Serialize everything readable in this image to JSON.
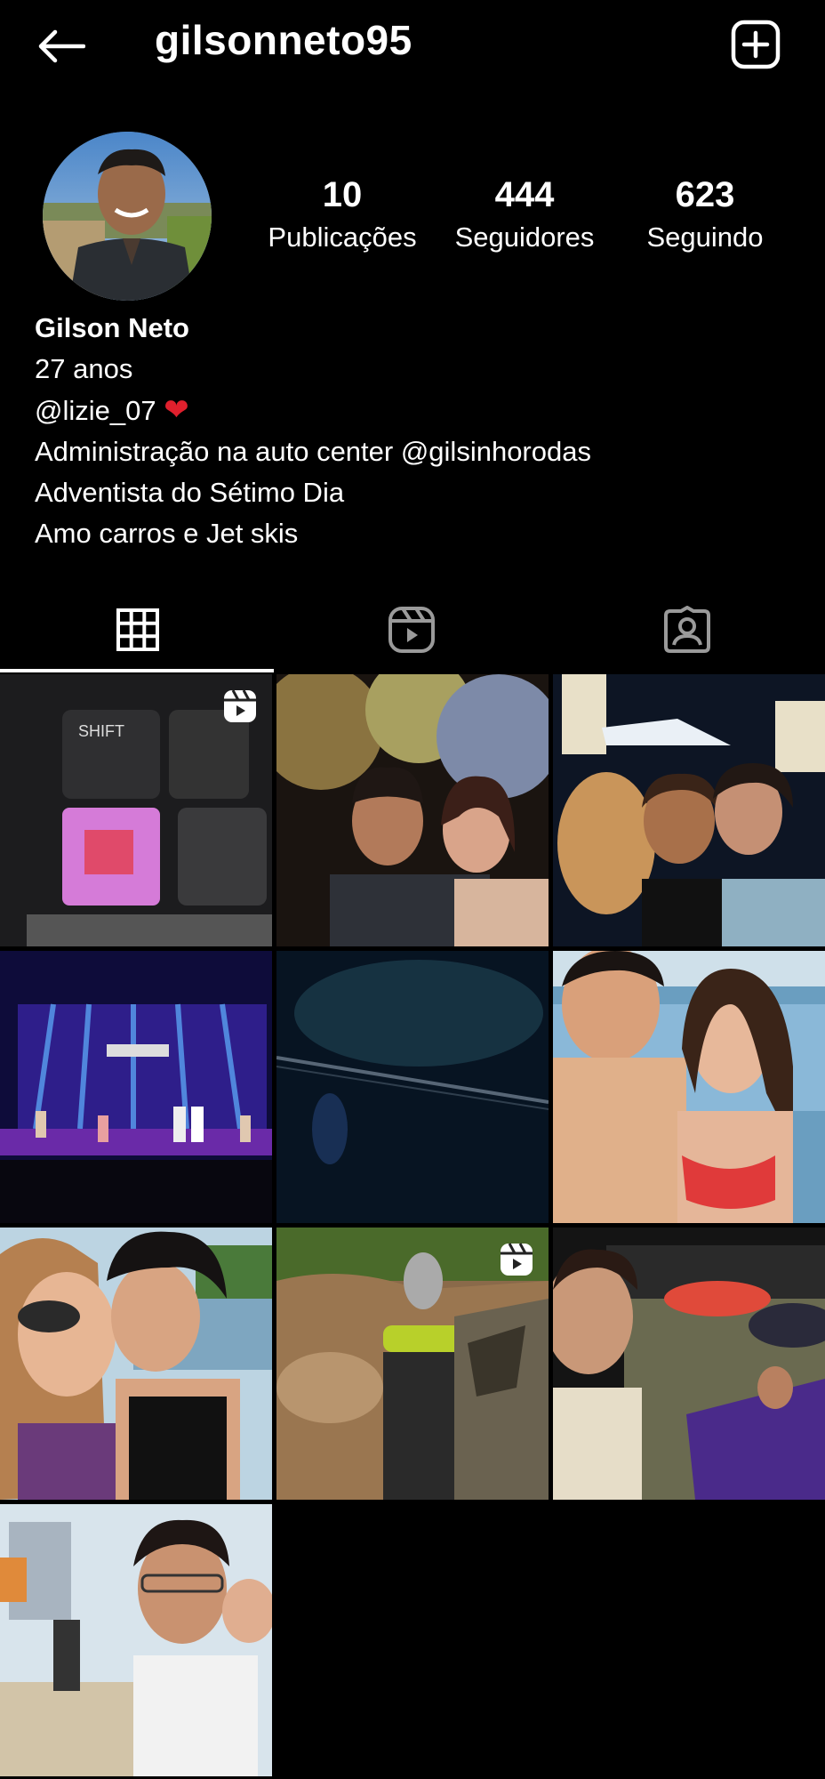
{
  "header": {
    "username": "gilsonneto95",
    "back_icon": "arrow-left-icon",
    "new_post_icon": "plus-square-icon"
  },
  "profile": {
    "stats": [
      {
        "value": "10",
        "label": "Publicações"
      },
      {
        "value": "444",
        "label": "Seguidores"
      },
      {
        "value": "623",
        "label": "Seguindo"
      }
    ],
    "bio": {
      "name": "Gilson Neto",
      "line1": "27 anos",
      "line2": "@lizie_07",
      "line2_emoji": "❤️",
      "line3": "Administração na auto center @gilsinhorodas",
      "line4": "Adventista do Sétimo Dia",
      "line5": "Amo carros e Jet skis"
    }
  },
  "tabs": [
    {
      "icon": "grid-icon",
      "active": true
    },
    {
      "icon": "reels-icon",
      "active": false
    },
    {
      "icon": "tagged-icon",
      "active": false
    }
  ],
  "posts": [
    {
      "name": "post-keyboard",
      "reel": true
    },
    {
      "name": "post-couple-flowers",
      "reel": false
    },
    {
      "name": "post-family-kiss",
      "reel": false
    },
    {
      "name": "post-stage-show",
      "reel": false
    },
    {
      "name": "post-night-window",
      "reel": false
    },
    {
      "name": "post-couple-beach",
      "reel": false
    },
    {
      "name": "post-couple-kiss-sea",
      "reel": false
    },
    {
      "name": "post-atv-mud",
      "reel": true
    },
    {
      "name": "post-selfie-crowd",
      "reel": false
    },
    {
      "name": "post-selfie-city-beach",
      "reel": false
    }
  ],
  "colors": {
    "background": "#000000",
    "text": "#ffffff",
    "heart": "#e0202d"
  }
}
